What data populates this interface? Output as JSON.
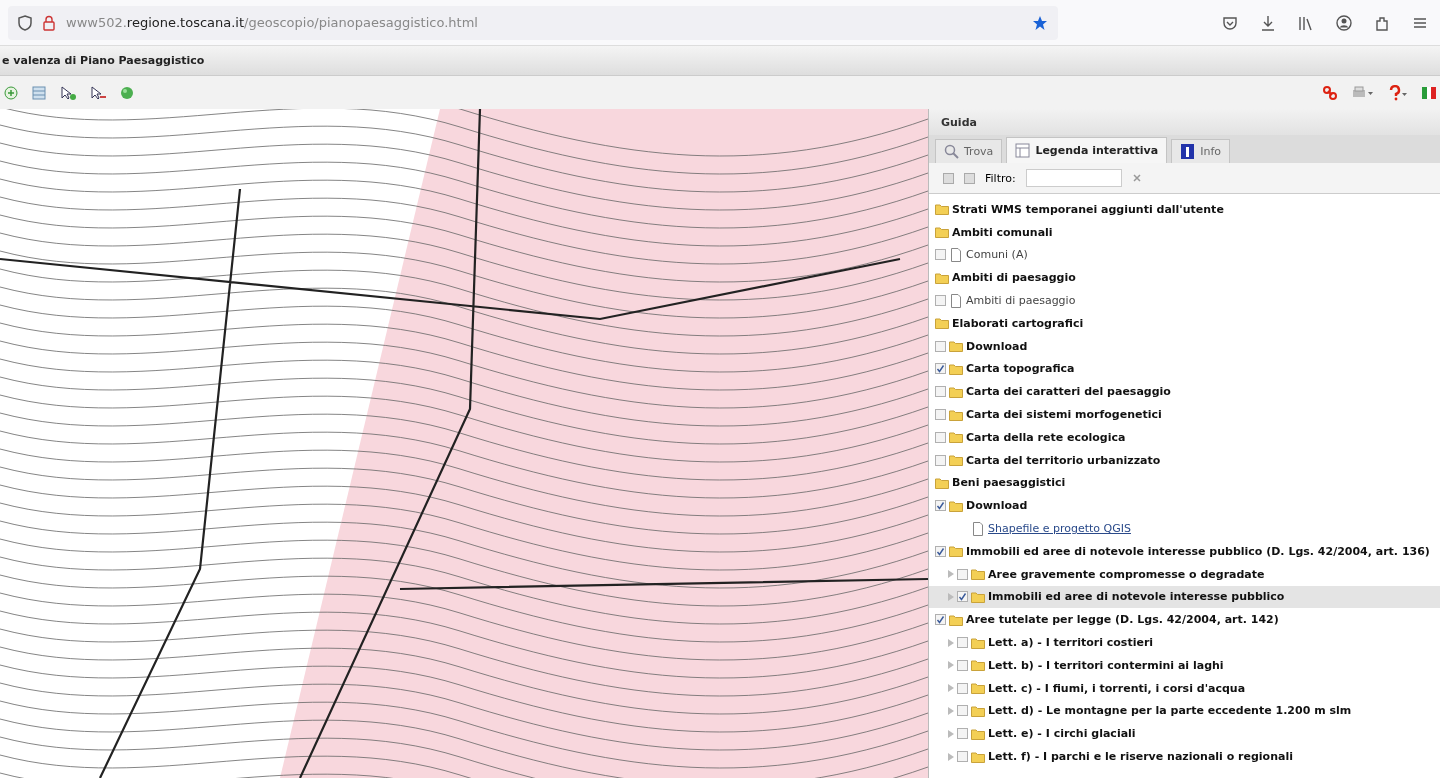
{
  "browser": {
    "url_prefix": "www502.",
    "url_domain": "regione.toscana.it",
    "url_path": "/geoscopio/pianopaesaggistico.html",
    "bookmarked": true
  },
  "app": {
    "title": "e valenza di Piano Paesaggistico"
  },
  "panel": {
    "title": "Guida",
    "tabs": [
      {
        "label": "Trova",
        "selected": false
      },
      {
        "label": "Legenda interattiva",
        "selected": true
      },
      {
        "label": "Info",
        "selected": false
      }
    ],
    "filter": {
      "label": "Filtro:"
    },
    "tree": [
      {
        "kind": "group",
        "label": "Strati WMS temporanei aggiunti dall'utente",
        "selected": false,
        "collapsed": false
      },
      {
        "kind": "group",
        "label": "Ambiti comunali",
        "selected": false,
        "collapsed": false,
        "children": [
          {
            "kind": "layer",
            "label": "Comuni (A)",
            "checked": false,
            "selected": false,
            "collapsed": false
          }
        ]
      },
      {
        "kind": "group",
        "label": "Ambiti di paesaggio",
        "selected": false,
        "collapsed": false,
        "children": [
          {
            "kind": "layer",
            "label": "Ambiti di paesaggio",
            "checked": false,
            "selected": false,
            "collapsed": false
          }
        ]
      },
      {
        "kind": "group",
        "label": "Elaborati cartografici",
        "selected": false,
        "collapsed": false,
        "children": [
          {
            "kind": "folder",
            "label": "Download",
            "checked": false,
            "selected": false,
            "collapsed": false
          },
          {
            "kind": "folder",
            "label": "Carta topografica",
            "checked": true,
            "selected": false,
            "collapsed": false
          },
          {
            "kind": "folder",
            "label": "Carta dei caratteri del paesaggio",
            "checked": false,
            "selected": false,
            "collapsed": false
          },
          {
            "kind": "folder",
            "label": "Carta dei sistemi morfogenetici",
            "checked": false,
            "selected": false,
            "collapsed": false
          },
          {
            "kind": "folder",
            "label": "Carta della rete ecologica",
            "checked": false,
            "selected": false,
            "collapsed": false
          },
          {
            "kind": "folder",
            "label": "Carta del territorio urbanizzato",
            "checked": false,
            "selected": false,
            "collapsed": false
          }
        ]
      },
      {
        "kind": "group",
        "label": "Beni paesaggistici",
        "selected": false,
        "collapsed": false,
        "children": [
          {
            "kind": "folder",
            "label": "Download",
            "checked": true,
            "selected": false,
            "collapsed": false,
            "children": [
              {
                "kind": "link",
                "label": "Shapefile e progetto QGIS",
                "selected": false,
                "collapsed": false
              }
            ]
          },
          {
            "kind": "folder",
            "label": "Immobili ed aree di notevole interesse pubblico (D. Lgs. 42/2004, art. 136)",
            "checked": true,
            "selected": false,
            "collapsed": false,
            "children": [
              {
                "kind": "folder",
                "label": "Aree gravemente compromesse o degradate",
                "checked": false,
                "selected": false,
                "collapsed": true
              },
              {
                "kind": "folder",
                "label": "Immobili ed aree di notevole interesse pubblico",
                "checked": true,
                "selected": true,
                "collapsed": true
              }
            ]
          },
          {
            "kind": "folder",
            "label": "Aree tutelate per legge (D. Lgs. 42/2004, art. 142)",
            "checked": true,
            "selected": false,
            "collapsed": false,
            "children": [
              {
                "kind": "folder",
                "label": "Lett. a) - I territori costieri",
                "checked": false,
                "selected": false,
                "collapsed": true
              },
              {
                "kind": "folder",
                "label": "Lett. b) - I territori contermini ai laghi",
                "checked": false,
                "selected": false,
                "collapsed": true
              },
              {
                "kind": "folder",
                "label": "Lett. c) - I fiumi, i torrenti, i corsi d'acqua",
                "checked": false,
                "selected": false,
                "collapsed": true
              },
              {
                "kind": "folder",
                "label": "Lett. d) - Le montagne per la parte eccedente 1.200 m slm",
                "checked": false,
                "selected": false,
                "collapsed": true
              },
              {
                "kind": "folder",
                "label": "Lett. e) - I circhi glaciali",
                "checked": false,
                "selected": false,
                "collapsed": true
              },
              {
                "kind": "folder",
                "label": "Lett. f) - I parchi e le riserve nazionali o regionali",
                "checked": false,
                "selected": false,
                "collapsed": true
              }
            ]
          }
        ]
      }
    ]
  }
}
